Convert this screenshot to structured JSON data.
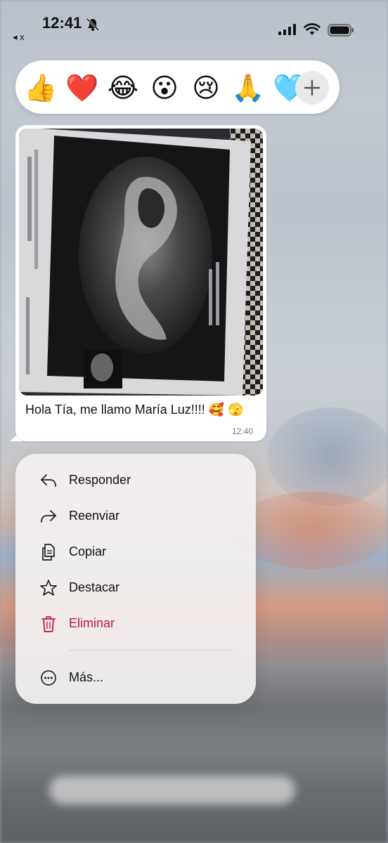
{
  "status_bar": {
    "time": "12:41",
    "back_label": "◂ x"
  },
  "reactions": {
    "items": [
      {
        "name": "thumbs-up",
        "glyph": "👍"
      },
      {
        "name": "red-heart",
        "glyph": "❤️"
      },
      {
        "name": "tears-of-joy",
        "glyph": "😂"
      },
      {
        "name": "surprised",
        "glyph": "😮"
      },
      {
        "name": "crying",
        "glyph": "😢"
      },
      {
        "name": "folded-hands",
        "glyph": "🙏"
      },
      {
        "name": "light-blue-heart",
        "glyph": "🩵"
      }
    ],
    "more_icon": "plus-icon"
  },
  "message": {
    "text": "Hola Tía, me llamo María Luz!!!! 🥰 🫣",
    "time": "12:40",
    "image": "ultrasound-photo"
  },
  "menu": {
    "items": [
      {
        "label": "Responder",
        "icon": "reply-icon"
      },
      {
        "label": "Reenviar",
        "icon": "forward-icon"
      },
      {
        "label": "Copiar",
        "icon": "copy-icon"
      },
      {
        "label": "Destacar",
        "icon": "star-icon"
      },
      {
        "label": "Eliminar",
        "icon": "trash-icon",
        "destructive": true
      },
      {
        "label": "Más...",
        "icon": "more-icon"
      }
    ],
    "destructive_color": "#c2183c"
  }
}
